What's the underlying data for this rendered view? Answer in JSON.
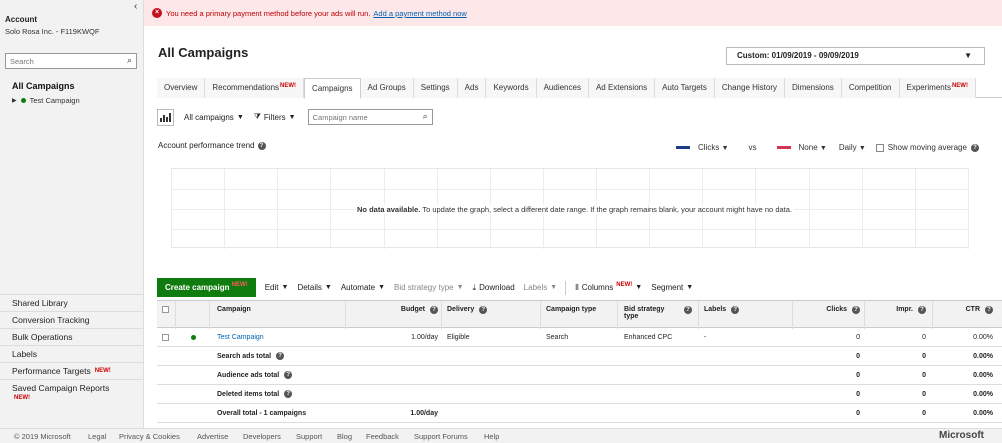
{
  "sidebar": {
    "account_label": "Account",
    "account_name": "Solo Rosa Inc. - F119KWQF",
    "search_placeholder": "Search",
    "all_campaigns": "All Campaigns",
    "tree_campaign": "Test Campaign",
    "links": [
      {
        "label": "Shared Library"
      },
      {
        "label": "Conversion Tracking"
      },
      {
        "label": "Bulk Operations"
      },
      {
        "label": "Labels"
      },
      {
        "label": "Performance Targets",
        "badge": "NEW!"
      },
      {
        "label": "Saved Campaign Reports",
        "badge": "NEW!"
      }
    ]
  },
  "alert": {
    "message": "You need a primary payment method before your ads will run.",
    "link": "Add a payment method now"
  },
  "header": {
    "title": "All Campaigns",
    "date_range": "Custom: 01/09/2019 - 09/09/2019"
  },
  "tabs": [
    {
      "label": "Overview"
    },
    {
      "label": "Recommendations",
      "badge": "NEW!"
    },
    {
      "label": "Campaigns",
      "active": true
    },
    {
      "label": "Ad Groups"
    },
    {
      "label": "Settings"
    },
    {
      "label": "Ads"
    },
    {
      "label": "Keywords"
    },
    {
      "label": "Audiences"
    },
    {
      "label": "Ad Extensions"
    },
    {
      "label": "Auto Targets"
    },
    {
      "label": "Change History"
    },
    {
      "label": "Dimensions"
    },
    {
      "label": "Competition"
    },
    {
      "label": "Experiments",
      "badge": "NEW!"
    }
  ],
  "toolbar": {
    "campaign_filter": "All campaigns",
    "filters": "Filters",
    "search_placeholder": "Campaign name"
  },
  "trend": {
    "label": "Account performance trend",
    "metric1": "Clicks",
    "metric1_color": "#1f3c88",
    "vs": "vs",
    "metric2": "None",
    "metric2_color": "#d1345b",
    "granularity": "Daily",
    "moving_average": "Show moving average",
    "nodata_bold": "No data available.",
    "nodata_text": "To update the graph, select a different date range. If the graph remains blank, your account might have no data."
  },
  "grid_toolbar": {
    "create": "Create campaign",
    "create_badge": "NEW!",
    "edit": "Edit",
    "details": "Details",
    "automate": "Automate",
    "bid_strategy": "Bid strategy type",
    "download": "Download",
    "labels": "Labels",
    "columns": "Columns",
    "columns_badge": "NEW!",
    "segment": "Segment"
  },
  "table": {
    "headers": {
      "campaign": "Campaign",
      "budget": "Budget",
      "delivery": "Delivery",
      "campaign_type": "Campaign type",
      "bid_strategy_1": "Bid strategy",
      "bid_strategy_2": "type",
      "labels": "Labels",
      "clicks": "Clicks",
      "impr": "Impr.",
      "ctr": "CTR"
    },
    "row": {
      "campaign": "Test Campaign",
      "budget": "1.00/day",
      "delivery": "Eligible",
      "campaign_type": "Search",
      "bid_strategy": "Enhanced CPC",
      "labels": "-",
      "clicks": "0",
      "impr": "0",
      "ctr": "0.00%"
    },
    "totals": [
      {
        "label": "Search ads total",
        "help": true,
        "budget": "",
        "clicks": "0",
        "impr": "0",
        "ctr": "0.00%"
      },
      {
        "label": "Audience ads total",
        "help": true,
        "budget": "",
        "clicks": "0",
        "impr": "0",
        "ctr": "0.00%"
      },
      {
        "label": "Deleted items total",
        "help": true,
        "budget": "",
        "clicks": "0",
        "impr": "0",
        "ctr": "0.00%"
      },
      {
        "label": "Overall total - 1 campaigns",
        "help": false,
        "budget": "1.00/day",
        "clicks": "0",
        "impr": "0",
        "ctr": "0.00%"
      }
    ]
  },
  "footer": {
    "copyright": "© 2019 Microsoft",
    "links": [
      "Legal",
      "Privacy & Cookies",
      "Advertise",
      "Developers",
      "Support",
      "Blog",
      "Feedback",
      "Support Forums",
      "Help"
    ],
    "brand": "Microsoft"
  }
}
